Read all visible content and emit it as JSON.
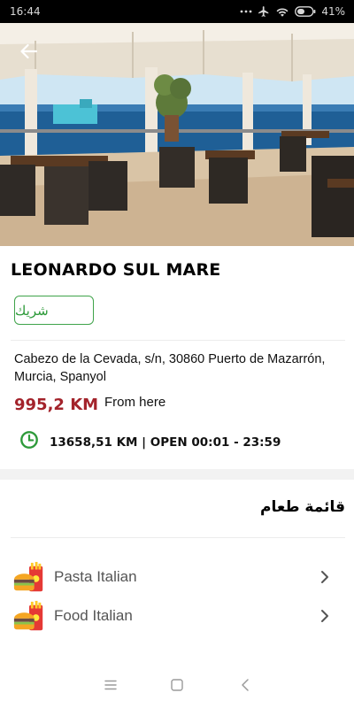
{
  "status_bar": {
    "time": "16:44",
    "battery_percent": "41%",
    "icons": [
      "more-dots-icon",
      "airplane-icon",
      "wifi-icon",
      "battery-icon"
    ]
  },
  "restaurant": {
    "name": "LEONARDO SUL MARE",
    "tag": "شريك",
    "address": "Cabezo de la Cevada, s/n, 30860 Puerto de Mazarrón, Murcia, Spanyol",
    "distance": "995,2 KM",
    "distance_suffix": "From here",
    "hours": "13658,51 KM | OPEN 00:01 - 23:59"
  },
  "menu": {
    "heading": "قائمة طعام",
    "items": [
      {
        "label": "Pasta Italian",
        "icon": "fast-food-icon"
      },
      {
        "label": "Food Italian",
        "icon": "fast-food-icon"
      }
    ]
  },
  "colors": {
    "distance": "#a3232b",
    "accent_green": "#3fa34a",
    "status_bar": "#000000"
  }
}
